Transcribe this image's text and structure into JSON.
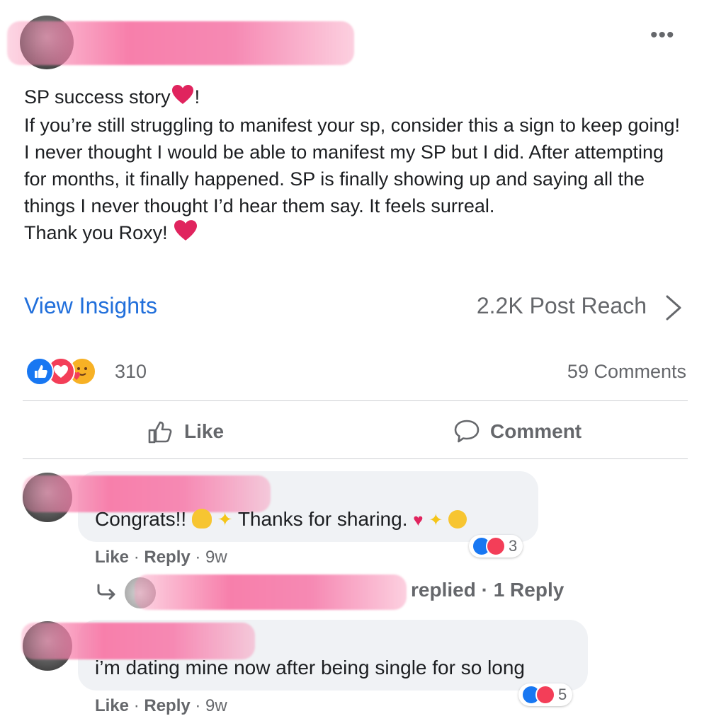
{
  "post": {
    "lines": [
      "SP success story",
      "If you’re still struggling to manifest your sp, consider this a sign to keep going! I never thought I would be able to manifest my SP but I did. After attempting for months, it finally happened. SP is finally showing up and saying all the things I never thought I’d hear them say. It feels surreal.",
      "Thank you Roxy!"
    ],
    "title_suffix": "!",
    "more_menu": "•••"
  },
  "insights": {
    "view_label": "View Insights",
    "reach_label": "2.2K Post Reach"
  },
  "reactions": {
    "icons": [
      "like-icon",
      "love-icon",
      "care-icon"
    ],
    "count": "310"
  },
  "comments_summary": "59 Comments",
  "actions": {
    "like_label": "Like",
    "comment_label": "Comment"
  },
  "comments": [
    {
      "text_a": "Congrats!!",
      "text_b": "Thanks for sharing.",
      "like": "Like",
      "reply": "Reply",
      "time": "9w",
      "reaction_count": "3",
      "reply_summary": "replied · 1 Reply"
    },
    {
      "text": "i’m dating mine now after being single for so long",
      "like": "Like",
      "reply": "Reply",
      "time": "9w",
      "reaction_count": "5"
    }
  ],
  "colors": {
    "accent": "#216fdb",
    "like_blue": "#1877f2",
    "love_red": "#f33e58",
    "muted": "#65676b",
    "bubble": "#f0f2f5"
  }
}
